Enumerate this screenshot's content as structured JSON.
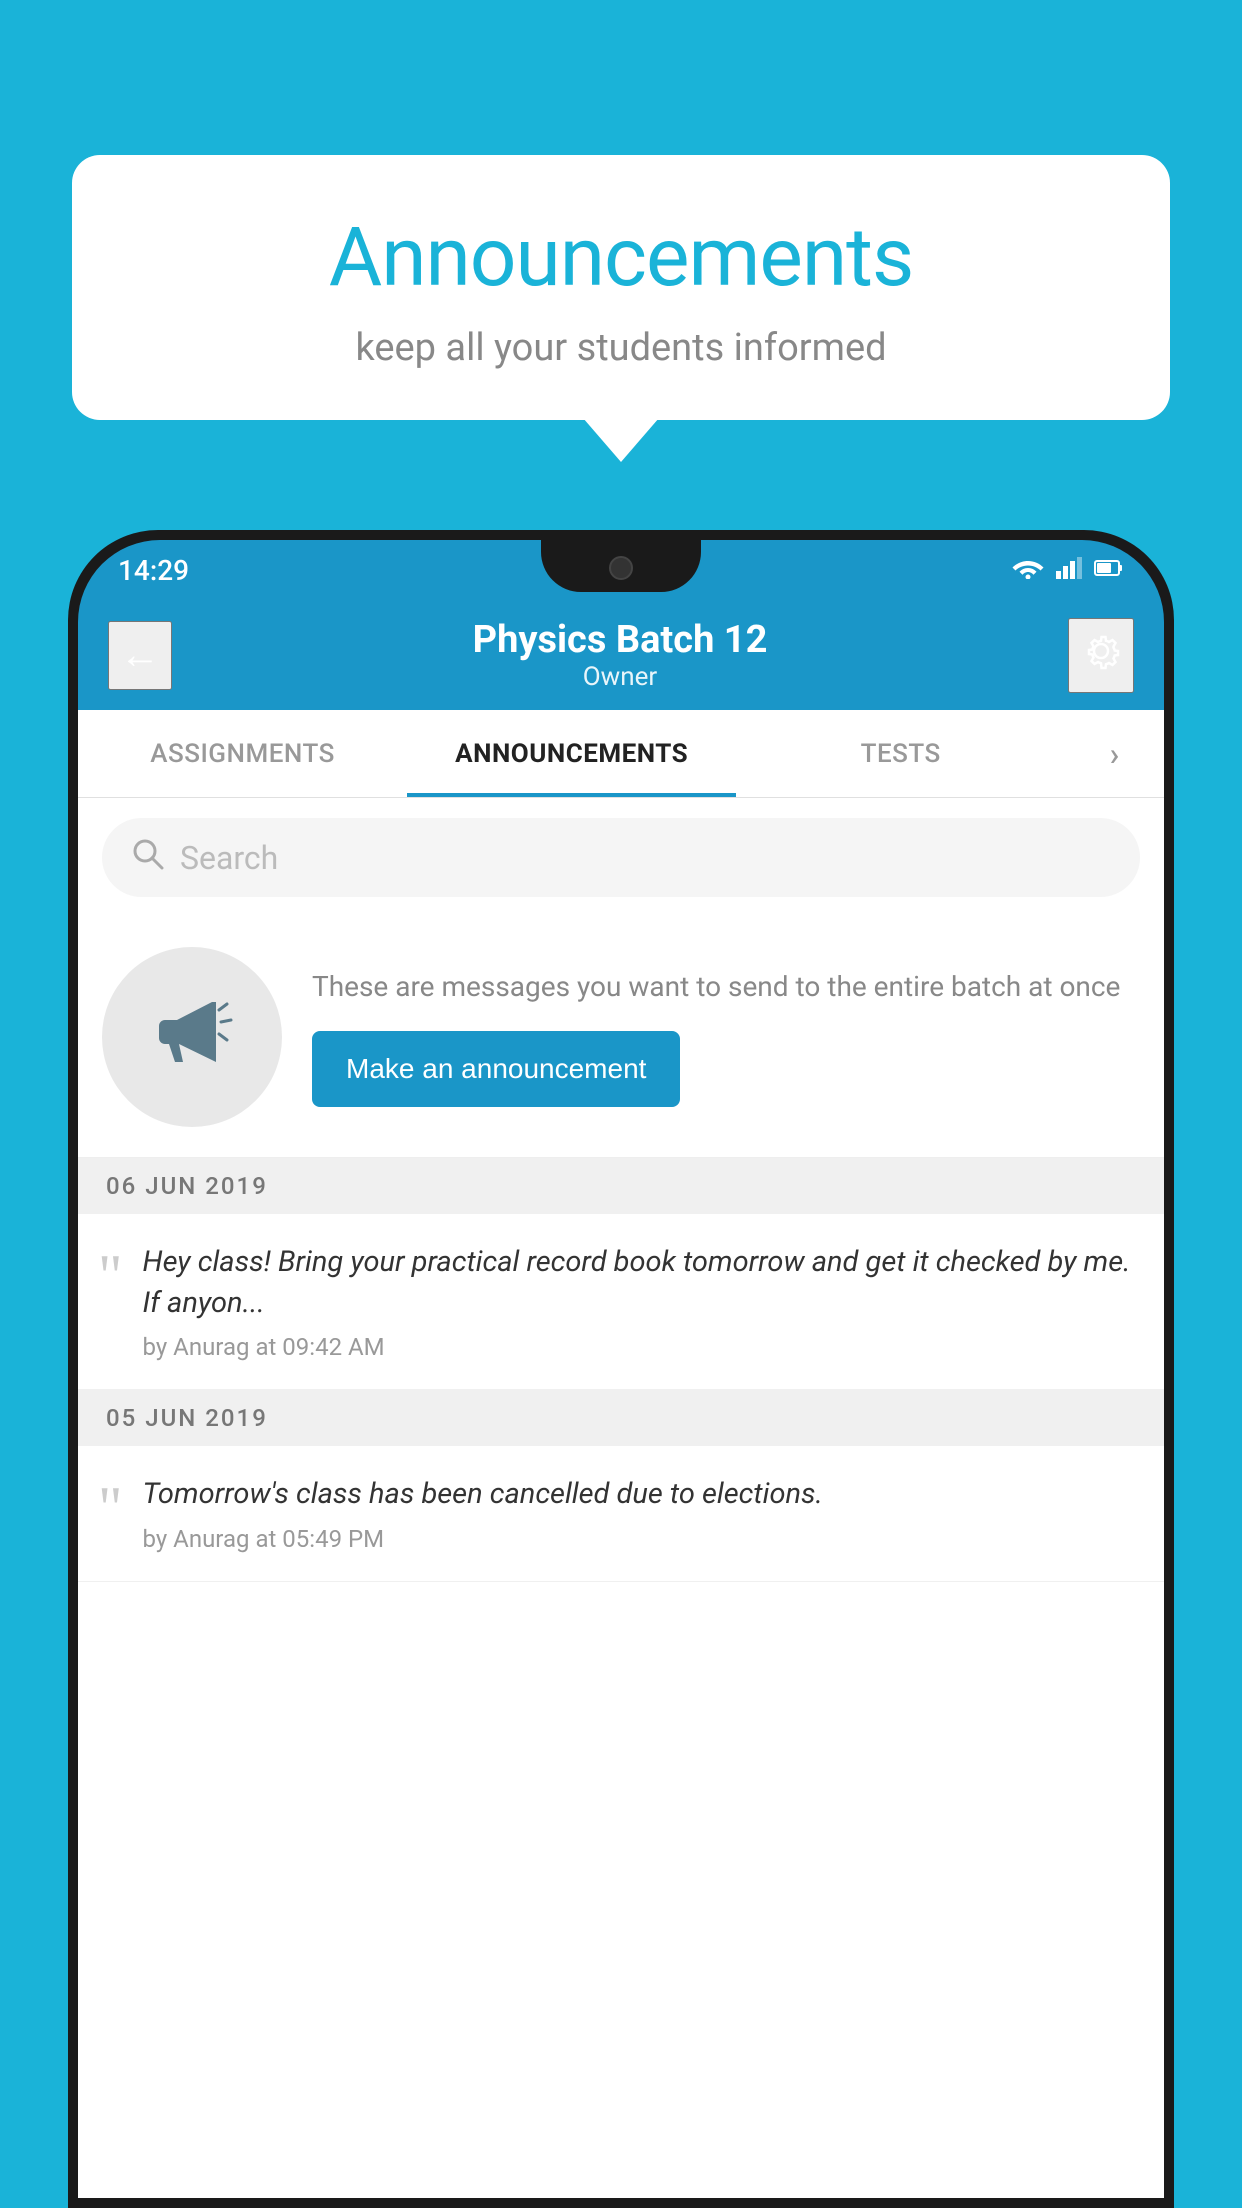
{
  "background_color": "#1ab3d8",
  "speech_bubble": {
    "title": "Announcements",
    "subtitle": "keep all your students informed"
  },
  "status_bar": {
    "time": "14:29",
    "wifi": "▼",
    "signal": "▲",
    "battery": "▮"
  },
  "app_bar": {
    "title": "Physics Batch 12",
    "subtitle": "Owner",
    "back_label": "←",
    "settings_label": "⚙"
  },
  "tabs": [
    {
      "label": "ASSIGNMENTS",
      "active": false
    },
    {
      "label": "ANNOUNCEMENTS",
      "active": true
    },
    {
      "label": "TESTS",
      "active": false
    },
    {
      "label": "›",
      "active": false
    }
  ],
  "search": {
    "placeholder": "Search"
  },
  "empty_state": {
    "description": "These are messages you want to send to the entire batch at once",
    "button_label": "Make an announcement"
  },
  "announcements": [
    {
      "date": "06  JUN  2019",
      "text": "Hey class! Bring your practical record book tomorrow and get it checked by me. If anyon...",
      "meta": "by Anurag at 09:42 AM"
    },
    {
      "date": "05  JUN  2019",
      "text": "Tomorrow's class has been cancelled due to elections.",
      "meta": "by Anurag at 05:49 PM"
    }
  ]
}
